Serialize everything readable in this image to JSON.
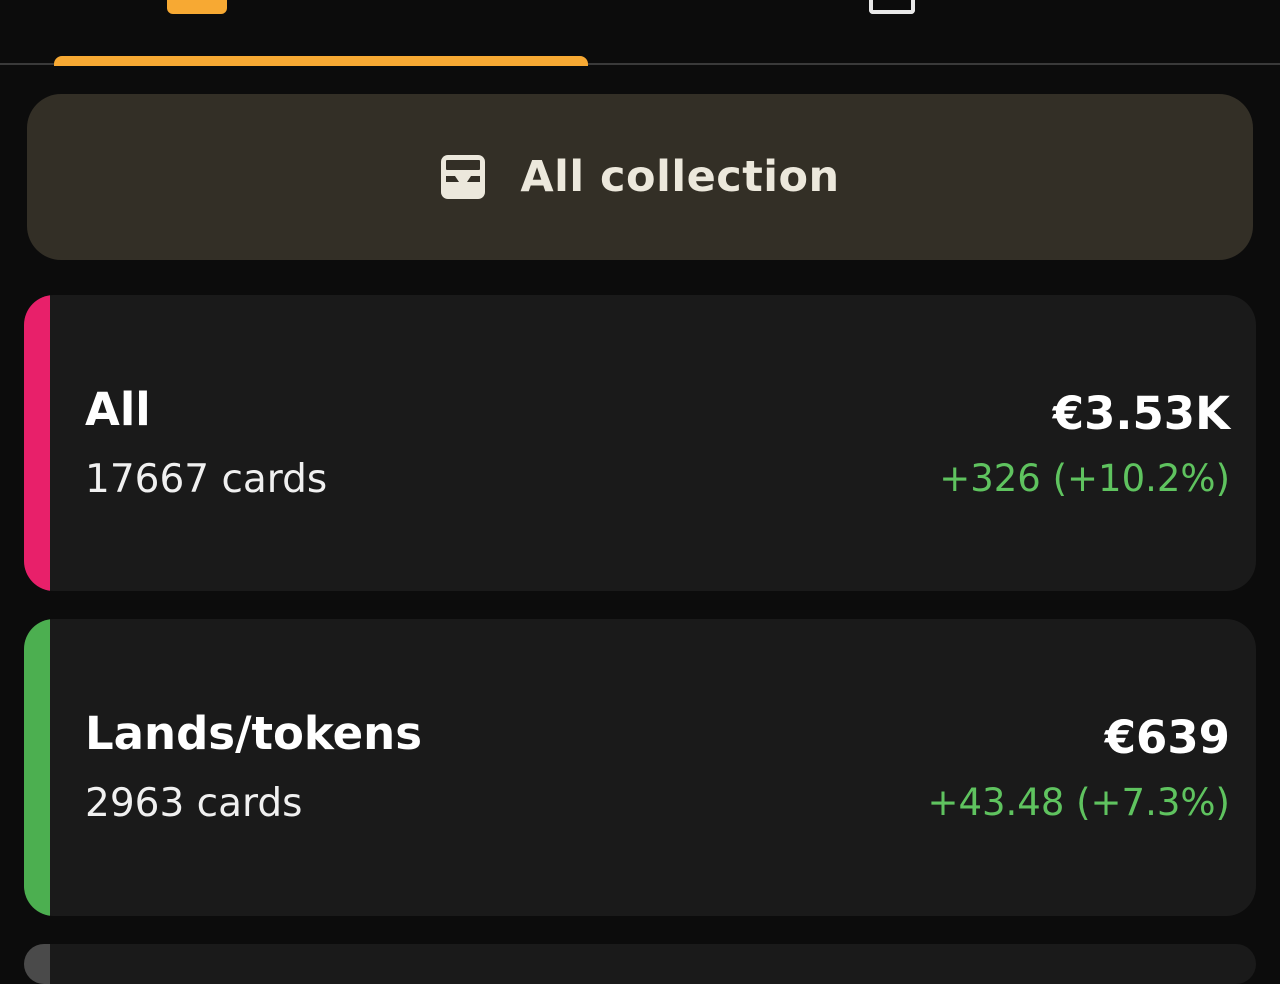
{
  "tabs": [
    {
      "name": "collections-tab",
      "icon": "folder-icon",
      "active": true
    },
    {
      "name": "lists-tab",
      "icon": "tray-icon",
      "active": false
    }
  ],
  "accent_color": "#f7a933",
  "collection_button": {
    "icon": "inbox-icon",
    "label": "All collection"
  },
  "folders": [
    {
      "name": "All",
      "count": "17667 cards",
      "value": "€3.53K",
      "change": "+326 (+10.2%)",
      "color": "#e8206a"
    },
    {
      "name": "Lands/tokens",
      "count": "2963 cards",
      "value": "€639",
      "change": "+43.48 (+7.3%)",
      "color": "#4caf50"
    }
  ],
  "peek_folder_color": "#4a4a4a",
  "positive_change_color": "#5fc35f"
}
